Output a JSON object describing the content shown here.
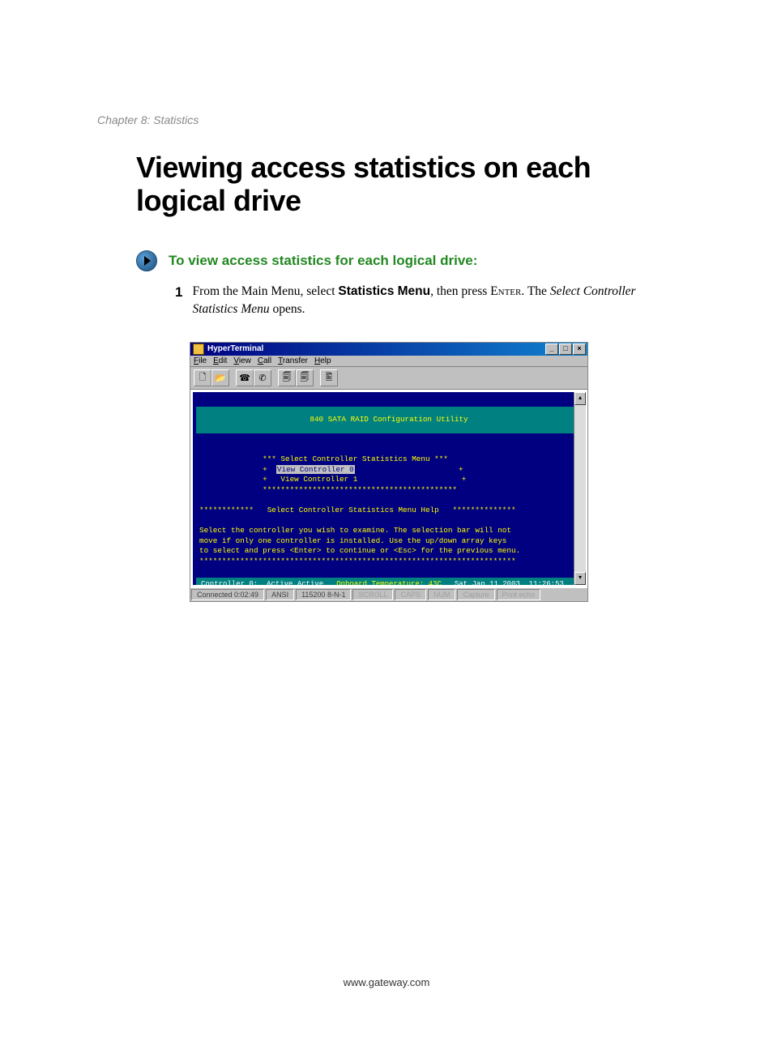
{
  "chapter_label": "Chapter 8: Statistics",
  "main_heading": "Viewing access statistics on each logical drive",
  "procedure_title": "To view access statistics for each logical drive:",
  "step1": {
    "number": "1",
    "pre": "From the Main Menu, select ",
    "bold1": "Statistics Menu",
    "mid": ", then press ",
    "smallcaps1": "Enter",
    "post1": ". The ",
    "italic1": "Select Controller Statistics Menu",
    "post2": " opens."
  },
  "ht": {
    "title": "HyperTerminal",
    "min": "_",
    "max": "□",
    "close": "×",
    "menu": {
      "file": "File",
      "edit": "Edit",
      "view": "View",
      "call": "Call",
      "transfer": "Transfer",
      "help": "Help"
    },
    "header": "840 SATA RAID Configuration Utility",
    "menu_title": "*** Select Controller Statistics Menu ***",
    "row0_pre": "+  ",
    "row0_label": "View Controller 0",
    "row0_post": "                       +",
    "row1": "+   View Controller 1                       +",
    "stars": "*******************************************",
    "help_title_pre": "************   ",
    "help_title": "Select Controller Statistics Menu Help",
    "help_title_post": "   **************",
    "help_l1": "Select the controller you wish to examine. The selection bar will not",
    "help_l2": "move if only one controller is installed. Use the up/down array keys",
    "help_l3": "to select and press <Enter> to continue or <Esc> for the previous menu.",
    "help_stars": "**********************************************************************",
    "status_ctrl": "Controller 0:  Active Active",
    "status_temp": "Onboard Temperature: 43C",
    "status_date": "Sat Jan 11 2003  11:26:53",
    "status": {
      "conn": "Connected 0:02:49",
      "emu": "ANSI",
      "baud": "115200 8-N-1",
      "scroll": "SCROLL",
      "caps": "CAPS",
      "num": "NUM",
      "capture": "Capture",
      "echo": "Print echo"
    }
  },
  "footer": "www.gateway.com"
}
